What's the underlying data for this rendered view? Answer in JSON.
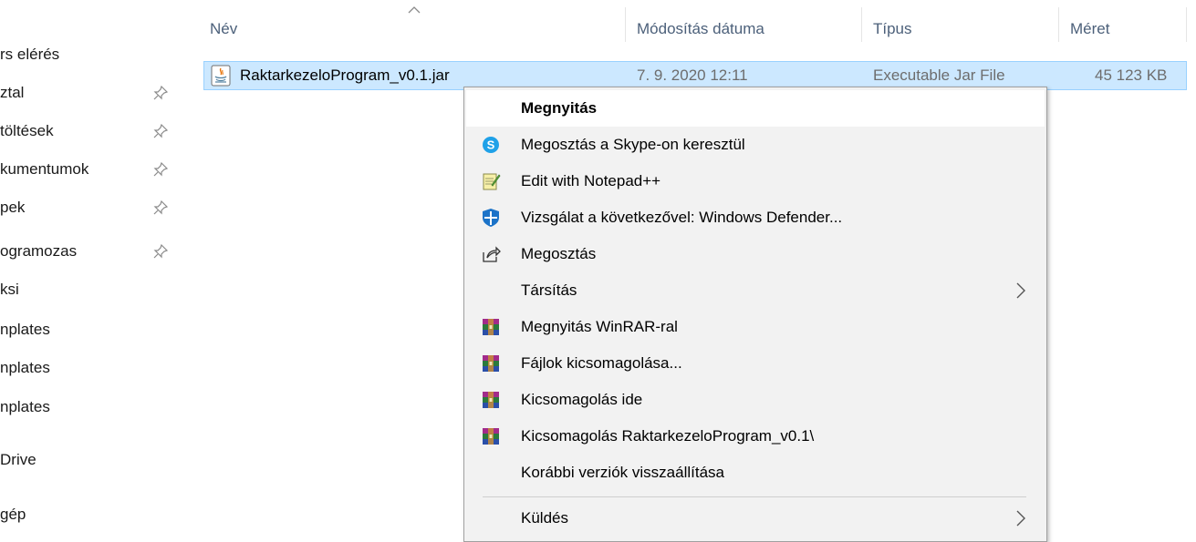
{
  "sidebar": {
    "items": [
      {
        "label": "rs elérés",
        "pinned": false
      },
      {
        "label": "ztal",
        "pinned": true
      },
      {
        "label": "töltések",
        "pinned": true
      },
      {
        "label": "kumentumok",
        "pinned": true
      },
      {
        "label": "pek",
        "pinned": true
      },
      {
        "label": "ogramozas",
        "pinned": true
      },
      {
        "label": "ksi",
        "pinned": false
      },
      {
        "label": "nplates",
        "pinned": false
      },
      {
        "label": "nplates",
        "pinned": false
      },
      {
        "label": "nplates",
        "pinned": false
      },
      {
        "label": "Drive",
        "pinned": false
      },
      {
        "label": "gép",
        "pinned": false
      }
    ]
  },
  "columns": {
    "name": "Név",
    "modified": "Módosítás dátuma",
    "type": "Típus",
    "size": "Méret"
  },
  "file": {
    "name": "RaktarkezeloProgram_v0.1.jar",
    "modified": "7. 9. 2020 12:11",
    "type": "Executable Jar File",
    "size": "45 123 KB"
  },
  "context_menu": {
    "items": [
      {
        "label": "Megnyitás",
        "icon": "none",
        "bold": true
      },
      {
        "label": "Megosztás a Skype-on keresztül",
        "icon": "skype-icon"
      },
      {
        "label": "Edit with Notepad++",
        "icon": "notepad-plus-plus-icon"
      },
      {
        "label": "Vizsgálat a következővel: Windows Defender...",
        "icon": "windows-defender-icon"
      },
      {
        "label": "Megosztás",
        "icon": "share-icon"
      },
      {
        "label": "Társítás",
        "icon": "none",
        "submenu": true
      },
      {
        "label": "Megnyitás WinRAR-ral",
        "icon": "winrar-icon"
      },
      {
        "label": "Fájlok kicsomagolása...",
        "icon": "winrar-icon"
      },
      {
        "label": "Kicsomagolás ide",
        "icon": "winrar-icon"
      },
      {
        "label": "Kicsomagolás RaktarkezeloProgram_v0.1\\",
        "icon": "winrar-icon"
      },
      {
        "label": "Korábbi verziók visszaállítása",
        "icon": "none"
      },
      {
        "label": "Küldés",
        "icon": "none",
        "submenu": true
      }
    ]
  },
  "colors": {
    "selection_bg": "#cce8ff",
    "selection_border": "#99d1ff",
    "menu_bg": "#f2f2f2",
    "header_text": "#4c607a"
  }
}
